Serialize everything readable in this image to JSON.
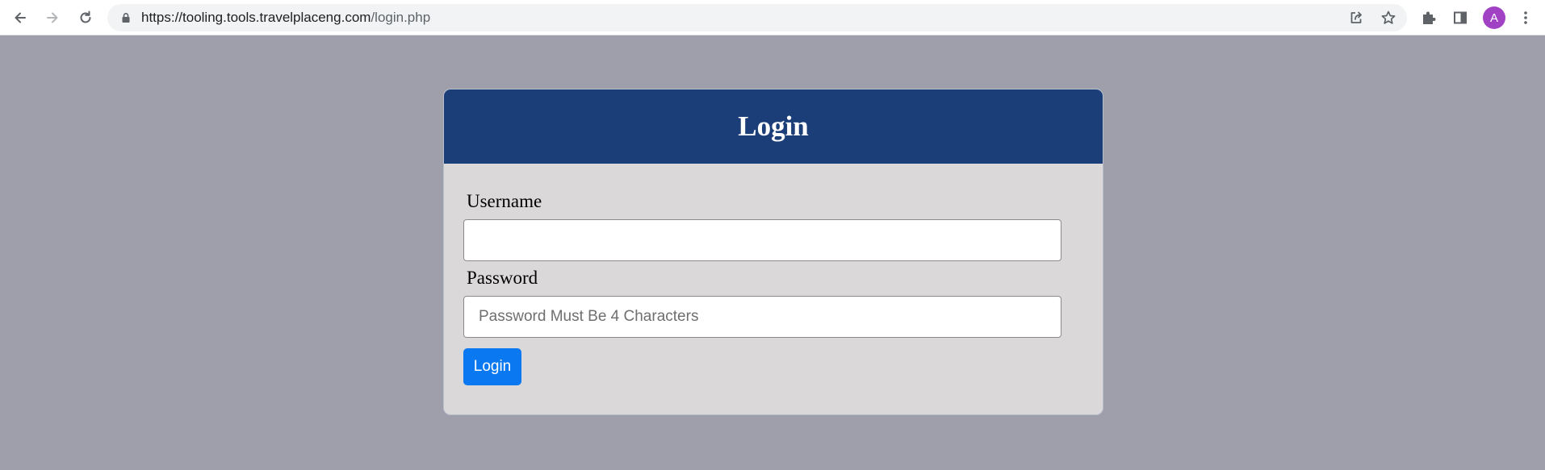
{
  "browser": {
    "url_domain": "https://tooling.tools.travelplaceng.com",
    "url_path": "/login.php",
    "avatar_letter": "A"
  },
  "login_card": {
    "title": "Login",
    "username_label": "Username",
    "username_value": "",
    "password_label": "Password",
    "password_placeholder": "Password Must Be 4 Characters",
    "submit_label": "Login"
  },
  "colors": {
    "page_background": "#9f9eab",
    "header_background": "#1b3e79",
    "card_background": "#dbd8da",
    "button_background": "#0a78f0",
    "avatar_background": "#a142c4"
  }
}
